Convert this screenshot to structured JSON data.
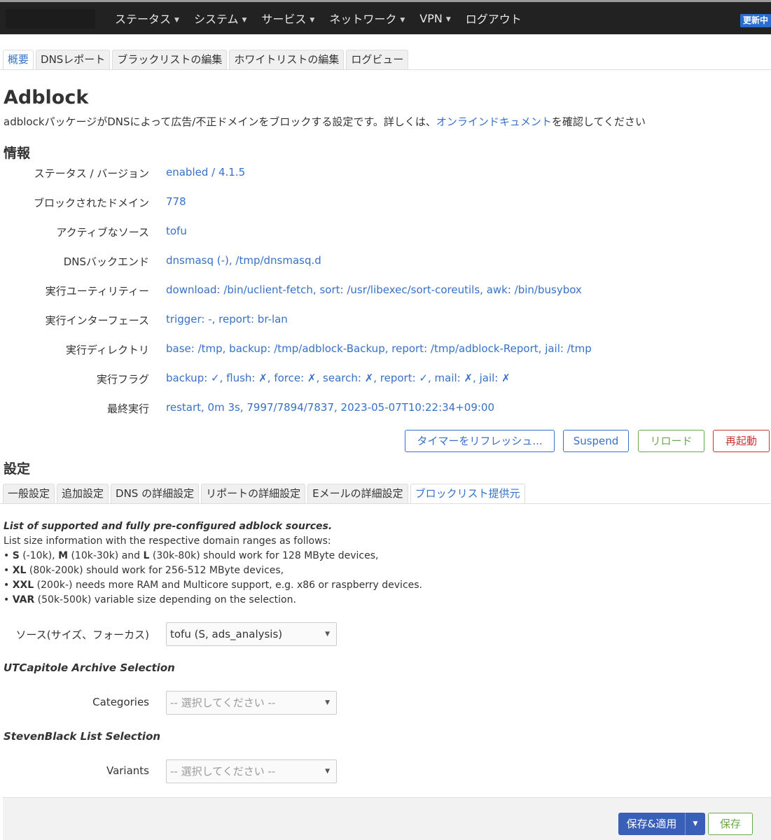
{
  "nav": {
    "items": [
      "ステータス",
      "システム",
      "サービス",
      "ネットワーク",
      "VPN",
      "ログアウト"
    ],
    "has_caret": [
      true,
      true,
      true,
      true,
      true,
      false
    ],
    "badge": "更新中"
  },
  "main_tabs": [
    "概要",
    "DNSレポート",
    "ブラックリストの編集",
    "ホワイトリストの編集",
    "ログビュー"
  ],
  "title": "Adblock",
  "description": {
    "prefix": "adblockパッケージがDNSによって広告/不正ドメインをブロックする設定です。詳しくは、",
    "link": "オンラインドキュメント",
    "suffix": "を確認してください"
  },
  "info": {
    "heading": "情報",
    "rows": [
      {
        "label": "ステータス / バージョン",
        "value": "enabled / 4.1.5"
      },
      {
        "label": "ブロックされたドメイン",
        "value": "778"
      },
      {
        "label": "アクティブなソース",
        "value": "tofu"
      },
      {
        "label": "DNSバックエンド",
        "value": "dnsmasq (-), /tmp/dnsmasq.d"
      },
      {
        "label": "実行ユーティリティー",
        "value": "download: /bin/uclient-fetch, sort: /usr/libexec/sort-coreutils, awk: /bin/busybox"
      },
      {
        "label": "実行インターフェース",
        "value": "trigger: -, report: br-lan"
      },
      {
        "label": "実行ディレクトリ",
        "value": "base: /tmp, backup: /tmp/adblock-Backup, report: /tmp/adblock-Report, jail: /tmp"
      },
      {
        "label": "実行フラグ",
        "value": "backup: ✓, flush: ✗, force: ✗, search: ✗, report: ✓, mail: ✗, jail: ✗"
      },
      {
        "label": "最終実行",
        "value": "restart, 0m 3s, 7997/7894/7837, 2023-05-07T10:22:34+09:00"
      }
    ]
  },
  "actions": {
    "refresh_timer": "タイマーをリフレッシュ...",
    "suspend": "Suspend",
    "reload": "リロード",
    "restart": "再起動"
  },
  "settings": {
    "heading": "設定",
    "tabs": [
      "一般設定",
      "追加設定",
      "DNS の詳細設定",
      "リポートの詳細設定",
      "Eメールの詳細設定",
      "ブロックリスト提供元"
    ],
    "active_tab": 5
  },
  "sources_info": {
    "heading": "List of supported and fully pre-configured adblock sources.",
    "line1": "List size information with the respective domain ranges as follows:",
    "b1": {
      "s": "S",
      "s_range": " (-10k), ",
      "m": "M",
      "m_range": " (10k-30k) and ",
      "l": "L",
      "rest": " (30k-80k) should work for 128 MByte devices,"
    },
    "b2": {
      "xl": "XL",
      "rest": " (80k-200k) should work for 256-512 MByte devices,"
    },
    "b3": {
      "xxl": "XXL",
      "rest": " (200k-) needs more RAM and Multicore support, e.g. x86 or raspberry devices."
    },
    "b4": {
      "var": "VAR",
      "rest": " (50k-500k) variable size depending on the selection."
    }
  },
  "form": {
    "source_label": "ソース(サイズ、フォーカス)",
    "source_value": "tofu (S, ads_analysis)",
    "utcapitole_heading": "UTCapitole Archive Selection",
    "categories_label": "Categories",
    "categories_placeholder": "-- 選択してください --",
    "stevenblack_heading": "StevenBlack List Selection",
    "variants_label": "Variants",
    "variants_placeholder": "-- 選択してください --"
  },
  "footer": {
    "save_apply": "保存&適用",
    "save": "保存"
  },
  "colors": {
    "topbar": "#222222",
    "link": "#3771c8",
    "primary": "#3a5fb8",
    "green": "#6aa84f",
    "red": "#cc3333"
  }
}
